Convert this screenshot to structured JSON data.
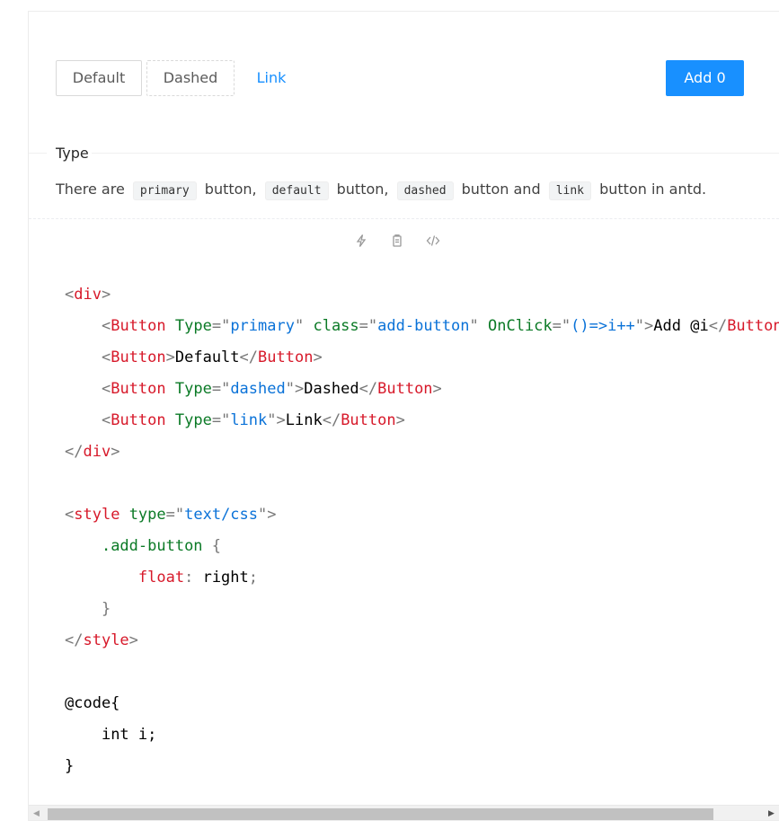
{
  "buttons": {
    "default_label": "Default",
    "dashed_label": "Dashed",
    "link_label": "Link",
    "add_label": "Add 0"
  },
  "meta": {
    "title": "Type",
    "desc_prefix": "There are",
    "code1": "primary",
    "mid1": "button,",
    "code2": "default",
    "mid2": "button,",
    "code3": "dashed",
    "mid3": "button and",
    "code4": "link",
    "suffix": "button in antd."
  },
  "actions": [
    "thunderbolt-icon",
    "copy-icon",
    "code-icon"
  ],
  "code": {
    "l1": [
      "<",
      "div",
      ">"
    ],
    "l2": [
      "<",
      "Button",
      "Type",
      "=\"",
      "primary",
      "\"",
      "class",
      "=\"",
      "add-button",
      "\"",
      "OnClick",
      "=\"",
      "()=>i++",
      "\">",
      "Add @i",
      "</",
      "Button",
      ">"
    ],
    "l3": [
      "<",
      "Button",
      ">",
      "Default",
      "</",
      "Button",
      ">"
    ],
    "l4": [
      "<",
      "Button",
      "Type",
      "=\"",
      "dashed",
      "\">",
      "Dashed",
      "</",
      "Button",
      ">"
    ],
    "l5": [
      "<",
      "Button",
      "Type",
      "=\"",
      "link",
      "\">",
      "Link",
      "</",
      "Button",
      ">"
    ],
    "l6": [
      "</",
      "div",
      ">"
    ],
    "l8": [
      "<",
      "style",
      "type",
      "=\"",
      "text/css",
      "\">"
    ],
    "l9": [
      ".add-button",
      "{"
    ],
    "l10": [
      "float",
      ":",
      "right",
      ";"
    ],
    "l11": [
      "}"
    ],
    "l12": [
      "</",
      "style",
      ">"
    ],
    "l14": "@code{",
    "l15": "int i;",
    "l16": "}"
  },
  "colors": {
    "primary": "#1890ff",
    "tag": "#d7192a",
    "attr": "#0b7a26",
    "string": "#0a72d8"
  }
}
